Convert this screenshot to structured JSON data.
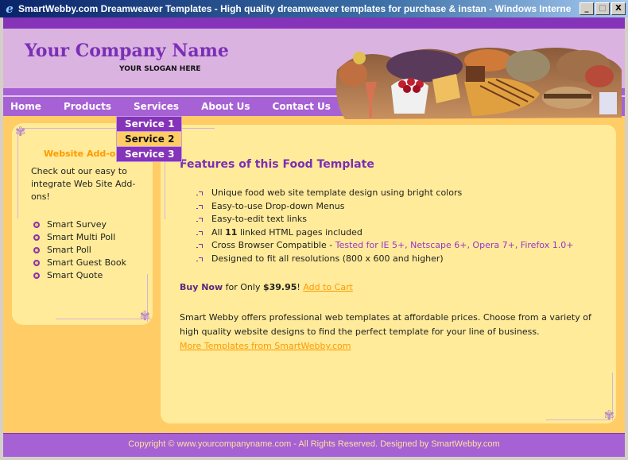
{
  "window": {
    "title": "SmartWebby.com Dreamweaver Templates - High quality dreamweaver templates for purchase & instan - Windows Interne...",
    "buttons": {
      "minimize": "_",
      "maximize": "□",
      "close": "X"
    }
  },
  "header": {
    "company_name": "Your Company Name",
    "slogan": "YOUR SLOGAN HERE",
    "banner_alt": "food-collage-banner"
  },
  "nav": {
    "items": [
      {
        "label": "Home"
      },
      {
        "label": "Products"
      },
      {
        "label": "Services"
      },
      {
        "label": "About Us"
      },
      {
        "label": "Contact Us"
      }
    ],
    "dropdown": [
      {
        "label": "Service 1"
      },
      {
        "label": "Service 2",
        "hover": true
      },
      {
        "label": "Service 3"
      }
    ]
  },
  "sidebar": {
    "title": "Website Add-ons",
    "text": "Check out our easy to integrate Web Site Add-ons!",
    "items": [
      {
        "label": "Smart Survey"
      },
      {
        "label": "Smart Multi Poll"
      },
      {
        "label": "Smart Poll"
      },
      {
        "label": "Smart Guest Book"
      },
      {
        "label": "Smart Quote"
      }
    ]
  },
  "main": {
    "title": "Features of this Food Template",
    "features": [
      {
        "text": "Unique food web site template design using bright colors"
      },
      {
        "text": "Easy-to-use Drop-down Menus"
      },
      {
        "text": "Easy-to-edit text links"
      },
      {
        "pre": "All ",
        "bold": "11",
        "post": " linked HTML pages included"
      },
      {
        "text": "Cross Browser Compatible - ",
        "highlight": "Tested for IE 5+, Netscape 6+, Opera 7+, Firefox 1.0+"
      },
      {
        "text": "Designed to fit all resolutions (800 x 600 and higher)"
      }
    ],
    "buy": {
      "buy_now": "Buy Now",
      "for_only": " for Only ",
      "price": "$39.95",
      "bang": "! ",
      "add_to_cart": "Add to Cart"
    },
    "description": "Smart Webby offers professional web templates at affordable prices. Choose from a variety of high quality website designs to find the perfect template for your line of business.",
    "more_link": "More Templates from SmartWebby.com"
  },
  "footer": {
    "text": "Copyright © www.yourcompanyname.com - All Rights Reserved. Designed by SmartWebby.com"
  },
  "colors": {
    "purple_dark": "#8533b8",
    "purple_mid": "#a661d4",
    "lavender": "#dab3e0",
    "orange_bg": "#ffcc66",
    "cream": "#ffeb99",
    "link_orange": "#ff9900"
  }
}
